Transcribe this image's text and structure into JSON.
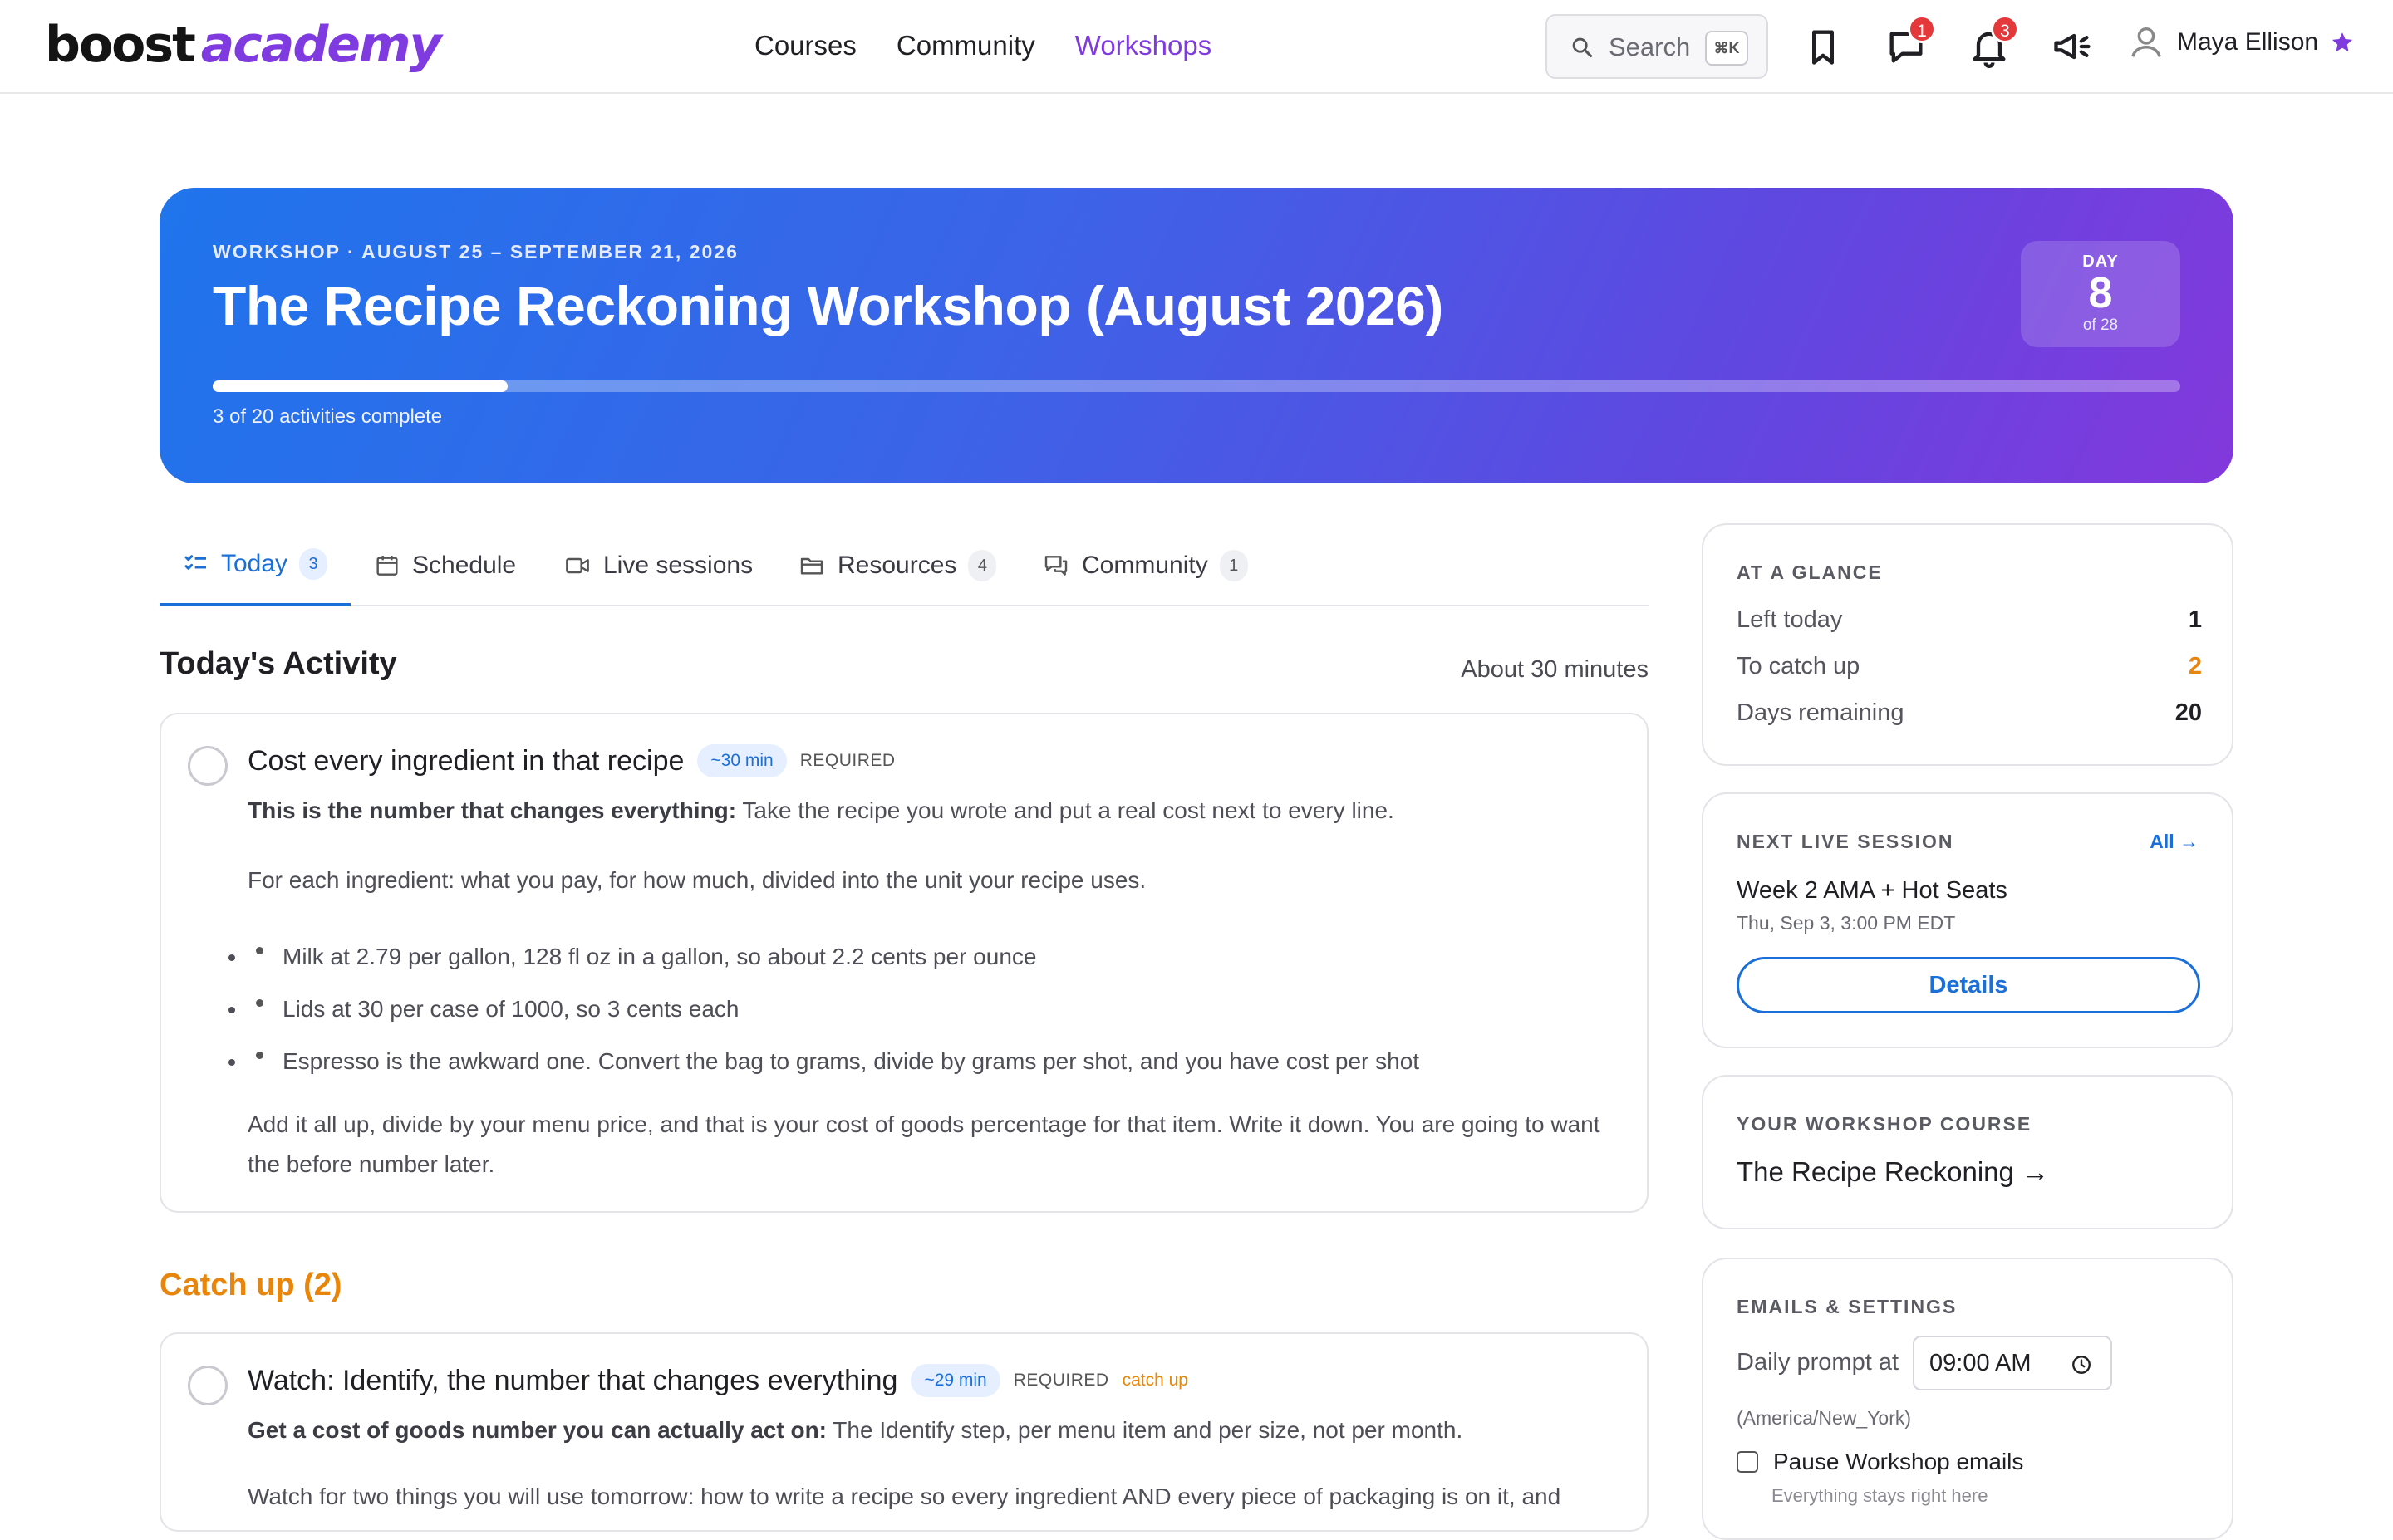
{
  "brand": {
    "part1": "boost",
    "part2": "academy"
  },
  "nav": {
    "links": [
      "Courses",
      "Community",
      "Workshops"
    ],
    "search": {
      "label": "Search",
      "shortcut": "⌘K"
    },
    "messages_badge": "1",
    "notifications_badge": "3",
    "user_name": "Maya Ellison"
  },
  "hero": {
    "eyebrow": "WORKSHOP · AUGUST 25 – SEPTEMBER 21, 2026",
    "title": "The Recipe Reckoning Workshop (August 2026)",
    "day_label": "DAY",
    "day_number": "8",
    "day_of": "of 28",
    "progress_fraction": 0.15,
    "progress_caption": "3 of 20 activities complete"
  },
  "tabs": [
    {
      "label": "Today",
      "count": "3"
    },
    {
      "label": "Schedule",
      "count": ""
    },
    {
      "label": "Live sessions",
      "count": ""
    },
    {
      "label": "Resources",
      "count": "4"
    },
    {
      "label": "Community",
      "count": "1"
    }
  ],
  "today": {
    "title": "Today's Activity",
    "duration": "About 30 minutes",
    "activity": {
      "title": "Cost every ingredient in that recipe",
      "time": "~30 min",
      "required": "REQUIRED",
      "lead_bold": "This is the number that changes everything:",
      "lead_text": " Take the recipe you wrote and put a real cost next to every line.",
      "para2": "For each ingredient: what you pay, for how much, divided into the unit your recipe uses.",
      "bullets": [
        "Milk at 2.79 per gallon, 128 fl oz in a gallon, so about 2.2 cents per ounce",
        "Lids at 30 per case of 1000, so 3 cents each",
        "Espresso is the awkward one. Convert the bag to grams, divide by grams per shot, and you have cost per shot"
      ],
      "para3": "Add it all up, divide by your menu price, and that is your cost of goods percentage for that item. Write it down. You are going to want the before number later."
    }
  },
  "catchup": {
    "title": "Catch up (2)",
    "activity": {
      "title": "Watch: Identify, the number that changes everything",
      "time": "~29 min",
      "required": "REQUIRED",
      "tag": "catch up",
      "lead_bold": "Get a cost of goods number you can actually act on:",
      "lead_text": " The Identify step, per menu item and per size, not per month.",
      "para2": "Watch for two things you will use tomorrow: how to write a recipe so every ingredient AND every piece of packaging is on it, and"
    }
  },
  "sidebar": {
    "glance": {
      "heading": "AT A GLANCE",
      "rows": [
        {
          "label": "Left today",
          "value": "1"
        },
        {
          "label": "To catch up",
          "value": "2"
        },
        {
          "label": "Days remaining",
          "value": "20"
        }
      ]
    },
    "next_session": {
      "heading": "NEXT LIVE SESSION",
      "all_link": "All →",
      "title": "Week 2 AMA + Hot Seats",
      "time": "Thu, Sep 3, 3:00 PM EDT",
      "button": "Details"
    },
    "course": {
      "heading": "YOUR WORKSHOP COURSE",
      "link": "The Recipe Reckoning →"
    },
    "settings": {
      "heading": "EMAILS & SETTINGS",
      "daily_prompt_label": "Daily prompt at",
      "daily_prompt_value": "09:00 AM",
      "timezone": "(America/New_York)",
      "pause_label": "Pause Workshop emails",
      "pause_sub": "Everything stays right here"
    }
  },
  "colors": {
    "accent_purple": "#7f3ae0",
    "accent_blue": "#1a6fd8",
    "catchup_orange": "#e8850c",
    "badge_red": "#e5383b"
  }
}
